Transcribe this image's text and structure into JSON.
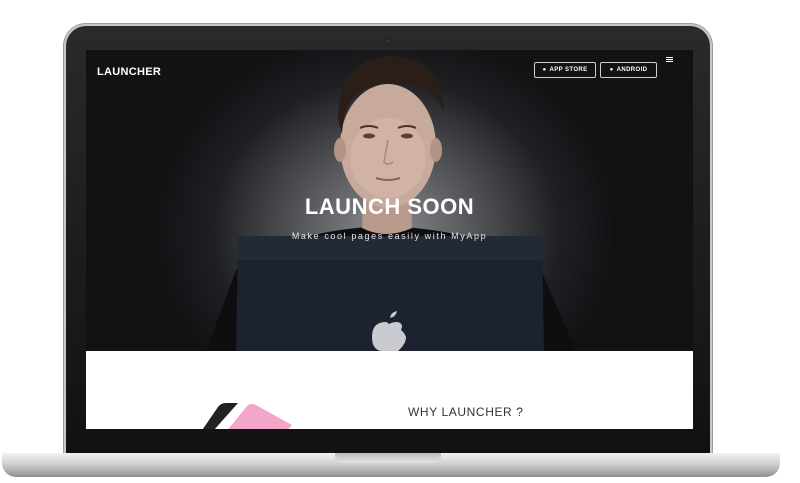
{
  "nav": {
    "brand": "LAUNCHER",
    "app_store_label": "APP STORE",
    "android_label": "ANDROID",
    "app_store_icon": "apple-icon",
    "android_icon": "android-icon",
    "menu_icon": "hamburger-menu-icon"
  },
  "hero": {
    "title": "LAUNCH SOON",
    "subtitle": "Make cool pages easily with MyApp"
  },
  "section": {
    "title": "WHY LAUNCHER ?"
  },
  "colors": {
    "hero_overlay": "#1a1b1e",
    "accent_pink": "#f4a6c8",
    "text_dark": "#333333"
  }
}
